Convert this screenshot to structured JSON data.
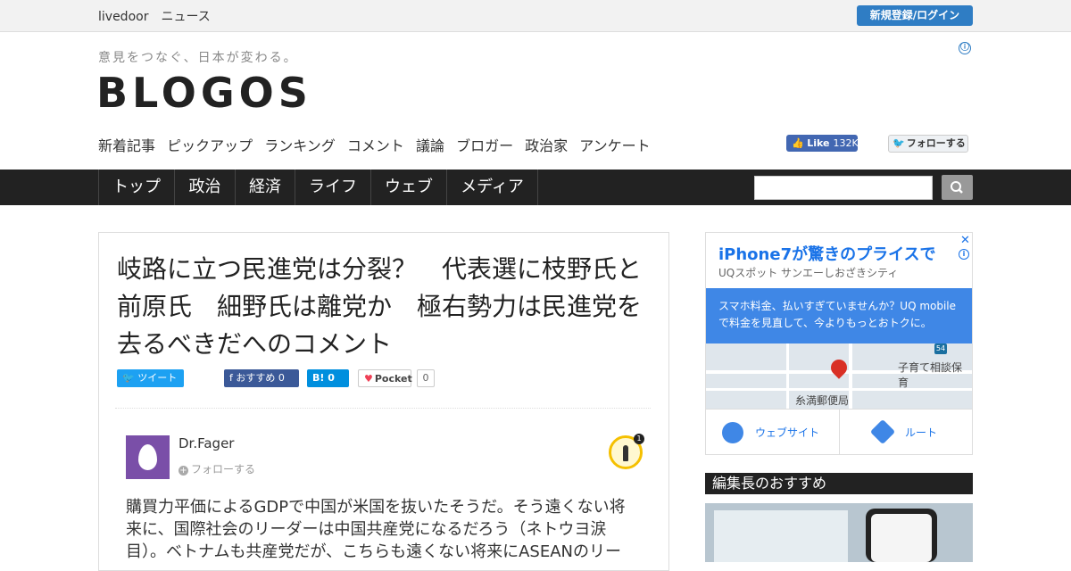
{
  "topbar": {
    "brand": "livedoor　ニュース",
    "login_label": "新規登録/ログイン"
  },
  "header": {
    "tagline": "意見をつなぐ、日本が変わる。",
    "logo": "BLOGOS",
    "info_icon": "ⓘ",
    "subnav": [
      "新着記事",
      "ピックアップ",
      "ランキング",
      "コメント",
      "議論",
      "ブロガー",
      "政治家",
      "アンケート"
    ],
    "fb_like": {
      "label": "Like",
      "count": "132K"
    },
    "tw_follow": "フォローする"
  },
  "categories": [
    "トップ",
    "政治",
    "経済",
    "ライフ",
    "ウェブ",
    "メディア"
  ],
  "search": {
    "placeholder": ""
  },
  "article": {
    "title": "岐路に立つ民進党は分裂？　代表選に枝野氏と前原氏　細野氏は離党か　極右勢力は民進党を去るべきだへのコメント",
    "share": {
      "tweet": "ツイート",
      "fb": "おすすめ",
      "fb_count": "0",
      "hatena": "B!",
      "hatena_count": "0",
      "pocket": "Pocket",
      "pocket_count": "0"
    },
    "comment": {
      "user": "Dr.Fager",
      "follow": "フォローする",
      "badge_count": "1",
      "text": "購買力平価によるGDPで中国が米国を抜いたそうだ。そう遠くない将来に、国際社会のリーダーは中国共産党になるだろう（ネトウヨ涙目）。ベトナムも共産党だが、こちらも遠くない将来にASEANのリー"
    }
  },
  "ad": {
    "title": "iPhone7が驚きのプライスで",
    "subtitle": "UQスポット サンエーしおざきシティ",
    "close": "✕",
    "info": "i",
    "blue_text": "スマホ料金、払いすぎていませんか？UQ mobileで料金を見直して、今よりもっとおトクに。",
    "map_label1": "子育て相談保育",
    "map_label2": "糸満郵便局",
    "map_badge": "54",
    "btn_website": "ウェブサイト",
    "btn_route": "ルート"
  },
  "sidebar": {
    "editor_title": "編集長のおすすめ"
  },
  "colors": {
    "accent": "#2f7dc4",
    "category_bar": "#222222",
    "ad_blue": "#3f87e6",
    "avatar": "#7a4fa8"
  }
}
